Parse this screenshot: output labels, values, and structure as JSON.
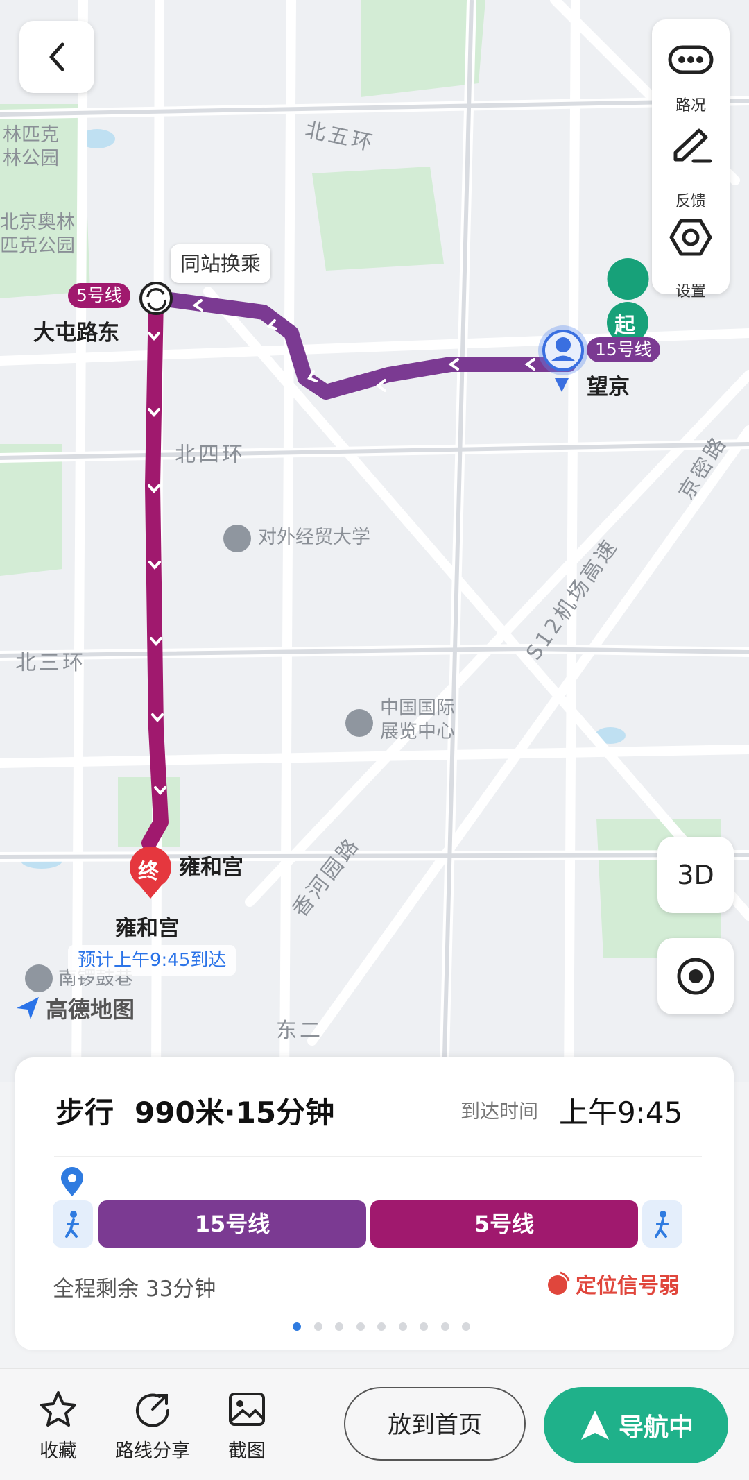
{
  "colors": {
    "line15": "#7b3a92",
    "line5": "#a0196e",
    "accent": "#1fb18a",
    "weak_signal": "#e0463c",
    "walk_icon": "#2f7be0"
  },
  "map": {
    "road_labels": [
      "北五环",
      "北四环",
      "北三环",
      "京密路",
      "S12机场高速",
      "香河园路",
      "东二"
    ],
    "area_labels": [
      "林匹克\n林公园",
      "北京奥林\n匹克公园",
      "对外经贸大学",
      "中国国际\n展览中心",
      "南锣鼓巷"
    ],
    "stations": {
      "start": "望京",
      "transfer": "大屯路东",
      "end": "雍和宫"
    },
    "transfer_hint": "同站换乘",
    "line_badges": {
      "line5": "5号线",
      "line15": "15号线"
    },
    "start_marker": "起",
    "end_marker": "终",
    "end_station_label": "雍和宫",
    "arrival_hint": "预计上午9:45到达",
    "logo": "高德地图"
  },
  "right_controls": [
    {
      "icon": "traffic-icon",
      "label": "路况"
    },
    {
      "icon": "feedback-icon",
      "label": "反馈"
    },
    {
      "icon": "settings-icon",
      "label": "设置"
    }
  ],
  "buttons": {
    "three_d": "3D"
  },
  "card": {
    "mode": "步行",
    "summary": "990米·15分钟",
    "arrive_label": "到达时间",
    "arrive_time": "上午9:45",
    "segments": [
      {
        "label": "15号线"
      },
      {
        "label": "5号线"
      }
    ],
    "remaining": "全程剩余 33分钟",
    "signal": "定位信号弱",
    "page_count": 9,
    "page_active": 0
  },
  "bottom": {
    "favorite": "收藏",
    "share": "路线分享",
    "screenshot": "截图",
    "home_btn": "放到首页",
    "nav_btn": "导航中"
  }
}
